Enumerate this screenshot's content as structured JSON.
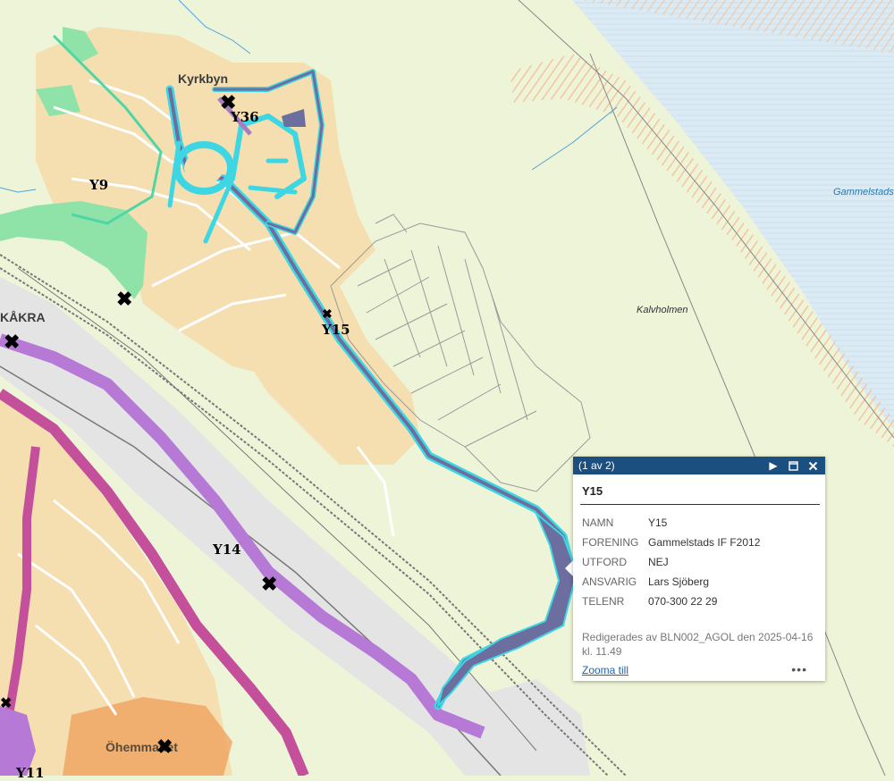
{
  "map": {
    "colors": {
      "background": "#eef4d8",
      "residential": "#f5deb0",
      "green_zone": "#8fe3a8",
      "industrial": "#e4e4e4",
      "water": "#dcebf3",
      "highlight_fill": "#6b6e9e",
      "highlight_outline": "#3fd6e4",
      "route_purple": "#b67ad6",
      "route_magenta": "#c44f9a",
      "orange_zone": "#ef9f5a"
    },
    "labels": {
      "kyrkbyn": "Kyrkbyn",
      "y36": "Y36",
      "y9": "Y9",
      "kakra": "KÅKRA",
      "y15": "Y15",
      "y14": "Y14",
      "ohemmanet": "Öhemmanet",
      "y11": "Y11",
      "kalvholmen": "Kalvholmen",
      "gammelstads": "Gammelstads"
    }
  },
  "popup": {
    "pager": "(1 av 2)",
    "title": "Y15",
    "fields": [
      {
        "key": "NAMN",
        "value": "Y15"
      },
      {
        "key": "FORENING",
        "value": "Gammelstads IF F2012"
      },
      {
        "key": "UTFORD",
        "value": "NEJ"
      },
      {
        "key": "ANSVARIG",
        "value": "Lars Sjöberg"
      },
      {
        "key": "TELENR",
        "value": "070-300 22 29"
      }
    ],
    "edited": "Redigerades av BLN002_AGOL den 2025-04-16 kl. 11.49",
    "zoom_label": "Zooma till",
    "more_label": "•••",
    "icons": {
      "next": "play-icon",
      "maximize": "maximize-icon",
      "close": "close-icon"
    }
  }
}
